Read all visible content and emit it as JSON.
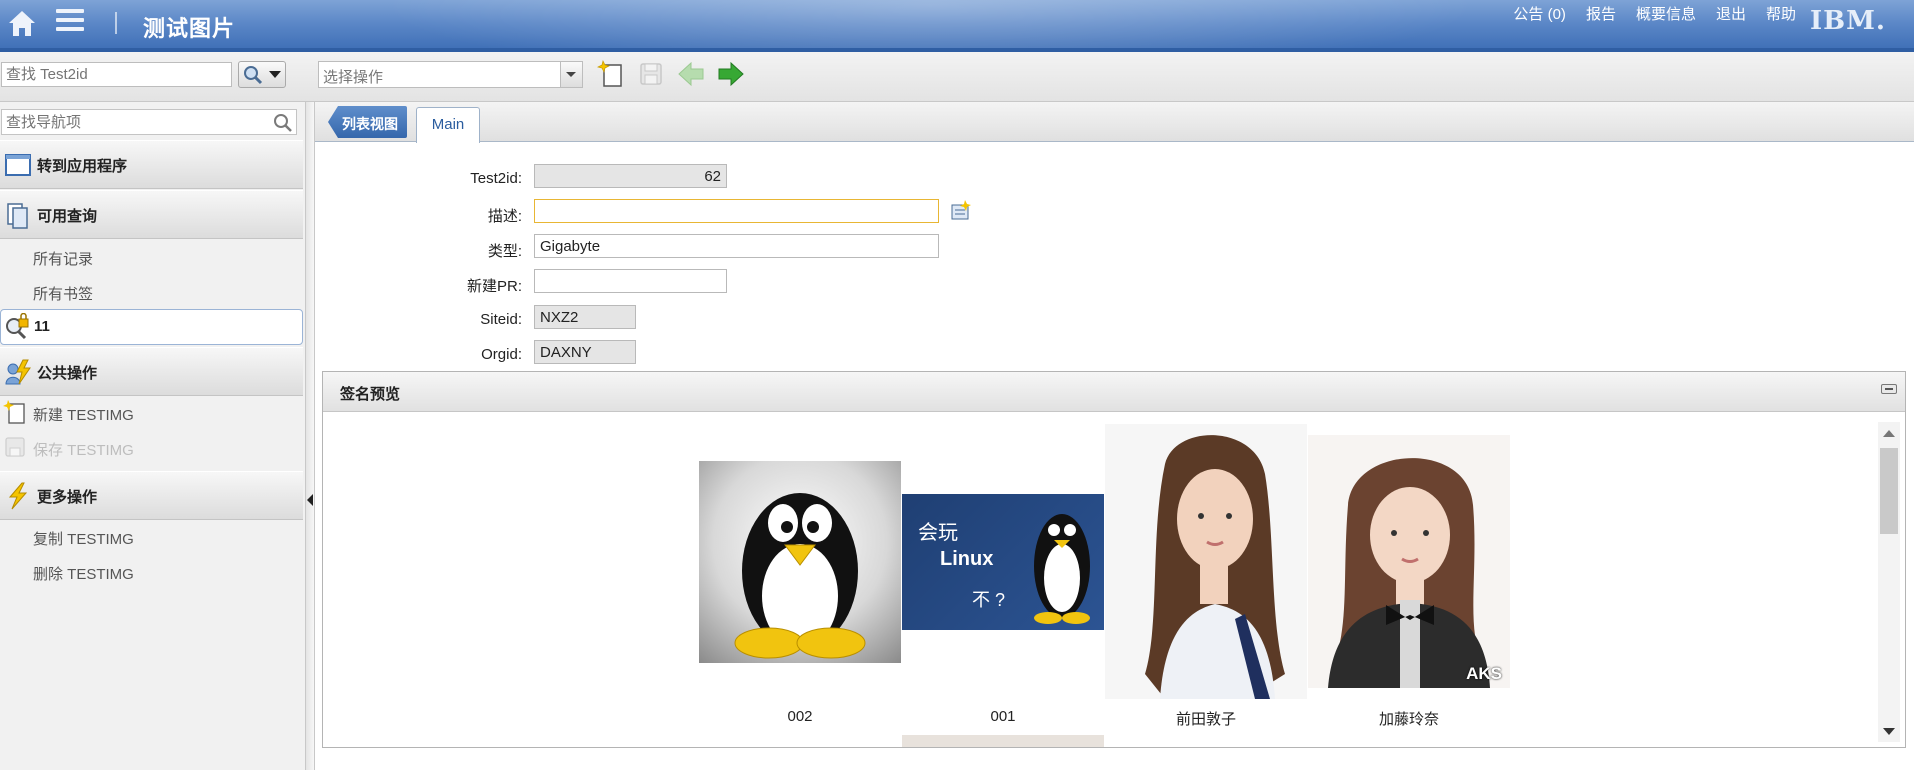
{
  "header": {
    "app_title": "测试图片",
    "links": [
      "公告 (0)",
      "报告",
      "概要信息",
      "退出",
      "帮助"
    ],
    "logo": "IBM."
  },
  "toolbar": {
    "search_placeholder": "查找 Test2id",
    "action_select": "选择操作"
  },
  "sidebar": {
    "nav_search_placeholder": "查找导航项",
    "goto_apps": "转到应用程序",
    "available_queries": "可用查询",
    "query_items": [
      "所有记录",
      "所有书签"
    ],
    "selected_query": "11",
    "common_actions": "公共操作",
    "common_items": [
      "新建 TESTIMG",
      "保存 TESTIMG"
    ],
    "more_actions": "更多操作",
    "more_items": [
      "复制 TESTIMG",
      "删除 TESTIMG"
    ]
  },
  "tabs": {
    "list_view": "列表视图",
    "main": "Main"
  },
  "form": {
    "test2id_label": "Test2id:",
    "test2id_value": "62",
    "desc_label": "描述:",
    "desc_value": "",
    "type_label": "类型:",
    "type_value": "Gigabyte",
    "newpr_label": "新建PR:",
    "newpr_value": "",
    "siteid_label": "Siteid:",
    "siteid_value": "NXZ2",
    "orgid_label": "Orgid:",
    "orgid_value": "DAXNY"
  },
  "signature_panel": {
    "title": "签名预览",
    "images": [
      {
        "caption": "002",
        "icon": "penguin-image"
      },
      {
        "caption": "001",
        "icon": "linux-banner-image",
        "text1": "会玩",
        "text2": "Linux",
        "text3": "不 ?"
      },
      {
        "caption": "前田敦子",
        "icon": "portrait-image"
      },
      {
        "caption": "加藤玲奈",
        "icon": "portrait-image",
        "overlay": "AKS"
      }
    ]
  },
  "colors": {
    "header_blue": "#3c6db5",
    "accent_blue": "#2b5d9f",
    "focus_border": "#e8b634"
  }
}
